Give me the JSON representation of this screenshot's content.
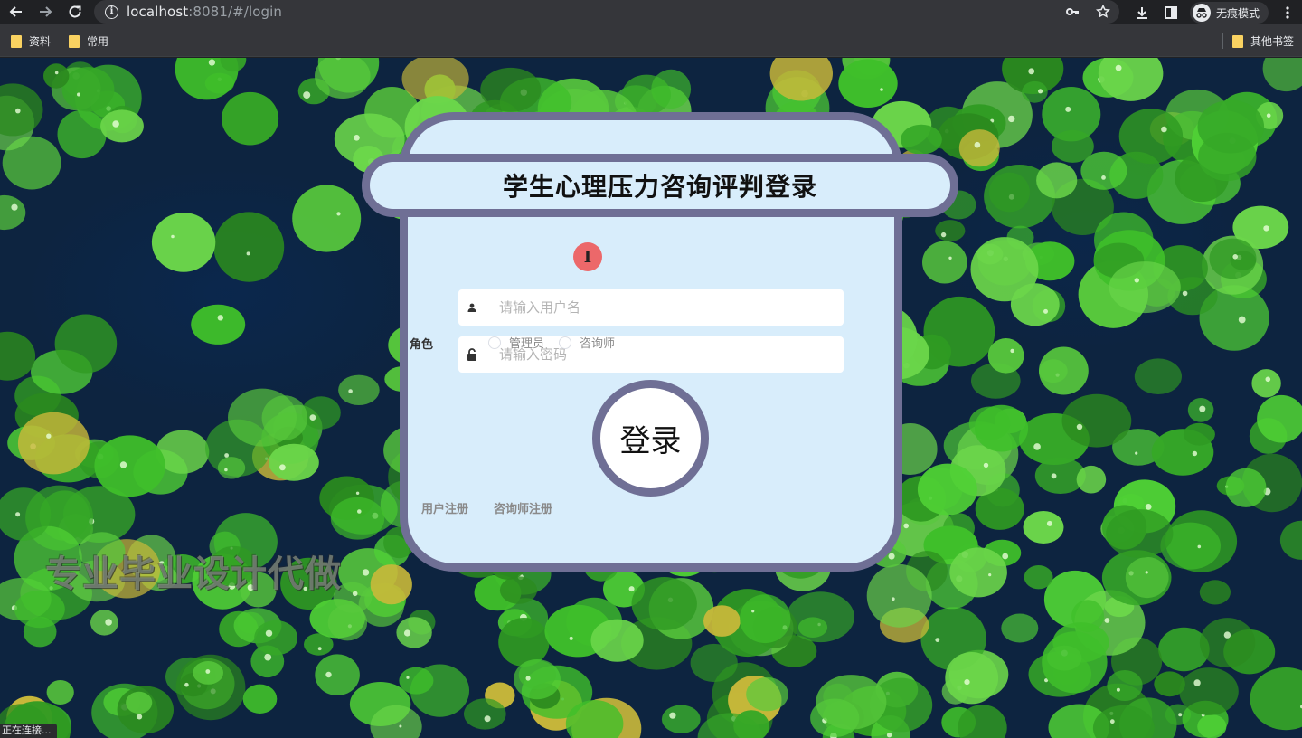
{
  "browser": {
    "url_host": "localhost",
    "url_rest": ":8081/#/login",
    "incognito_label": "无痕模式",
    "bookmarks": [
      "资料",
      "常用"
    ],
    "other_bookmarks": "其他书签",
    "status_text": "正在连接..."
  },
  "login": {
    "title": "学生心理压力咨询评判登录",
    "username_placeholder": "请输入用户名",
    "password_placeholder": "请输入密码",
    "role_label": "角色",
    "roles": [
      "管理员",
      "咨询师"
    ],
    "login_button": "登录",
    "links": [
      "用户注册",
      "咨询师注册"
    ]
  },
  "overlay": {
    "watermark": "专业毕业设计代做"
  },
  "colors": {
    "card_bg": "#d8edfb",
    "card_border": "#6f6f95",
    "leaf_green": "#3fbf2a"
  }
}
